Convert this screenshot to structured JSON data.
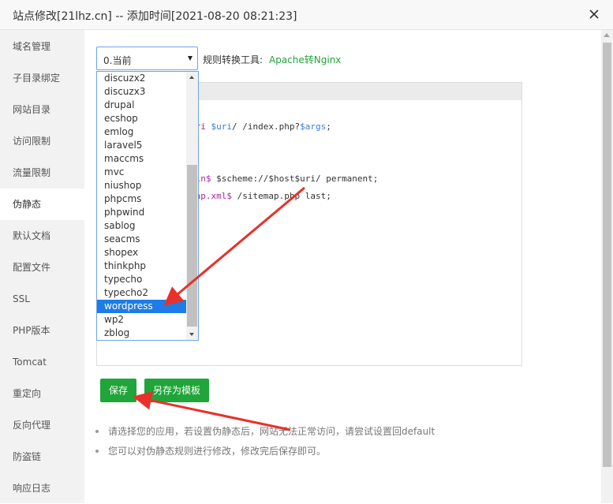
{
  "window": {
    "title": "站点修改[21lhz.cn] -- 添加时间[2021-08-20 08:21:23]"
  },
  "sidebar": {
    "items": [
      {
        "label": "域名管理"
      },
      {
        "label": "子目录绑定"
      },
      {
        "label": "网站目录"
      },
      {
        "label": "访问限制"
      },
      {
        "label": "流量限制"
      },
      {
        "label": "伪静态"
      },
      {
        "label": "默认文档"
      },
      {
        "label": "配置文件"
      },
      {
        "label": "SSL"
      },
      {
        "label": "PHP版本"
      },
      {
        "label": "Tomcat"
      },
      {
        "label": "重定向"
      },
      {
        "label": "反向代理"
      },
      {
        "label": "防盗链"
      },
      {
        "label": "响应日志"
      }
    ],
    "active": "伪静态"
  },
  "rewrite": {
    "select_value": "0.当前",
    "tool_label": "规则转换工具:",
    "tool_link": "Apache转Nginx",
    "options": [
      "discuzx2",
      "discuzx3",
      "drupal",
      "ecshop",
      "emlog",
      "laravel5",
      "maccms",
      "mvc",
      "niushop",
      "phpcms",
      "phpwind",
      "sablog",
      "seacms",
      "shopex",
      "thinkphp",
      "typecho",
      "typecho2",
      "wordpress",
      "wp2",
      "zblog"
    ],
    "selected_option": "wordpress"
  },
  "editor": {
    "line1_kw": "uri",
    "line1_var": "$uri",
    "line1_rest": "/ /index.php?",
    "line1_var2": "$args",
    "line1_end": ";",
    "line2_kw": "min$",
    "line2_rest": " $scheme://$host$uri/ permanent;",
    "line3_kw": "map.xml$",
    "line3_rest": " /sitemap.php last;"
  },
  "buttons": {
    "save": "保存",
    "save_template": "另存为模板"
  },
  "tips": [
    "请选择您的应用，若设置伪静态后，网站无法正常访问，请尝试设置回default",
    "您可以对伪静态规则进行修改，修改完后保存即可。"
  ],
  "colors": {
    "accent_green": "#20a53a",
    "select_highlight": "#1e7ce8",
    "annotation_arrow": "#e8312a"
  },
  "icons": {
    "close": "close-icon",
    "dropdown": "chevron-down-icon"
  }
}
